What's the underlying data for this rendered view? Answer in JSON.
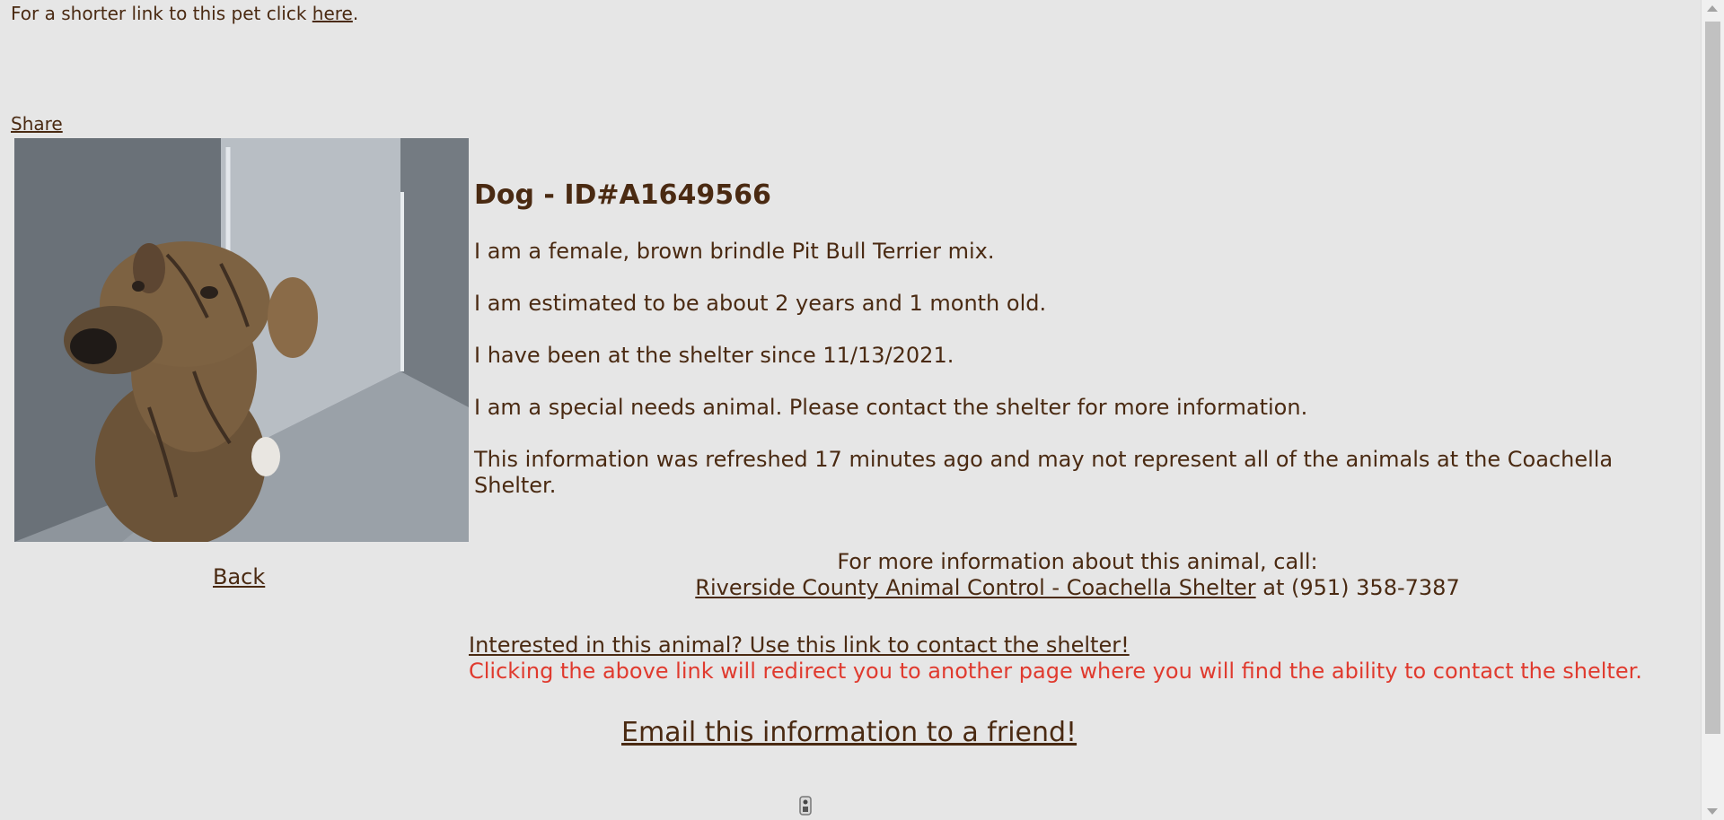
{
  "top": {
    "shorter_link_text": "For a shorter link to this pet click ",
    "shorter_link_anchor": "here",
    "shorter_link_end": "."
  },
  "share_label": "Share",
  "photo": {
    "alt": "Photo of dog A1649566"
  },
  "back_label": "Back",
  "animal": {
    "title": "Dog - ID#A1649566",
    "line1": "I am a female, brown brindle Pit Bull Terrier mix.",
    "line2": "I am estimated to be about 2 years and 1 month old.",
    "line3": "I have been at the shelter since 11/13/2021.",
    "line4": "I am a special needs animal. Please contact the shelter for more information.",
    "line5": "This information was refreshed 17 minutes ago and may not represent all of the animals at the Coachella Shelter."
  },
  "contact": {
    "intro": "For more information about this animal, call:",
    "shelter_link": "Riverside County Animal Control - Coachella Shelter",
    "phone_text": " at (951) 358-7387"
  },
  "interested": {
    "link": "Interested in this animal? Use this link to contact the shelter!",
    "note": "Clicking the above link will redirect you to another page where you will find the ability to contact the shelter."
  },
  "email_label": "Email this information to a friend!",
  "colors": {
    "background": "#e6e6e6",
    "text": "#4a2a12",
    "note_red": "#e03a2e"
  }
}
